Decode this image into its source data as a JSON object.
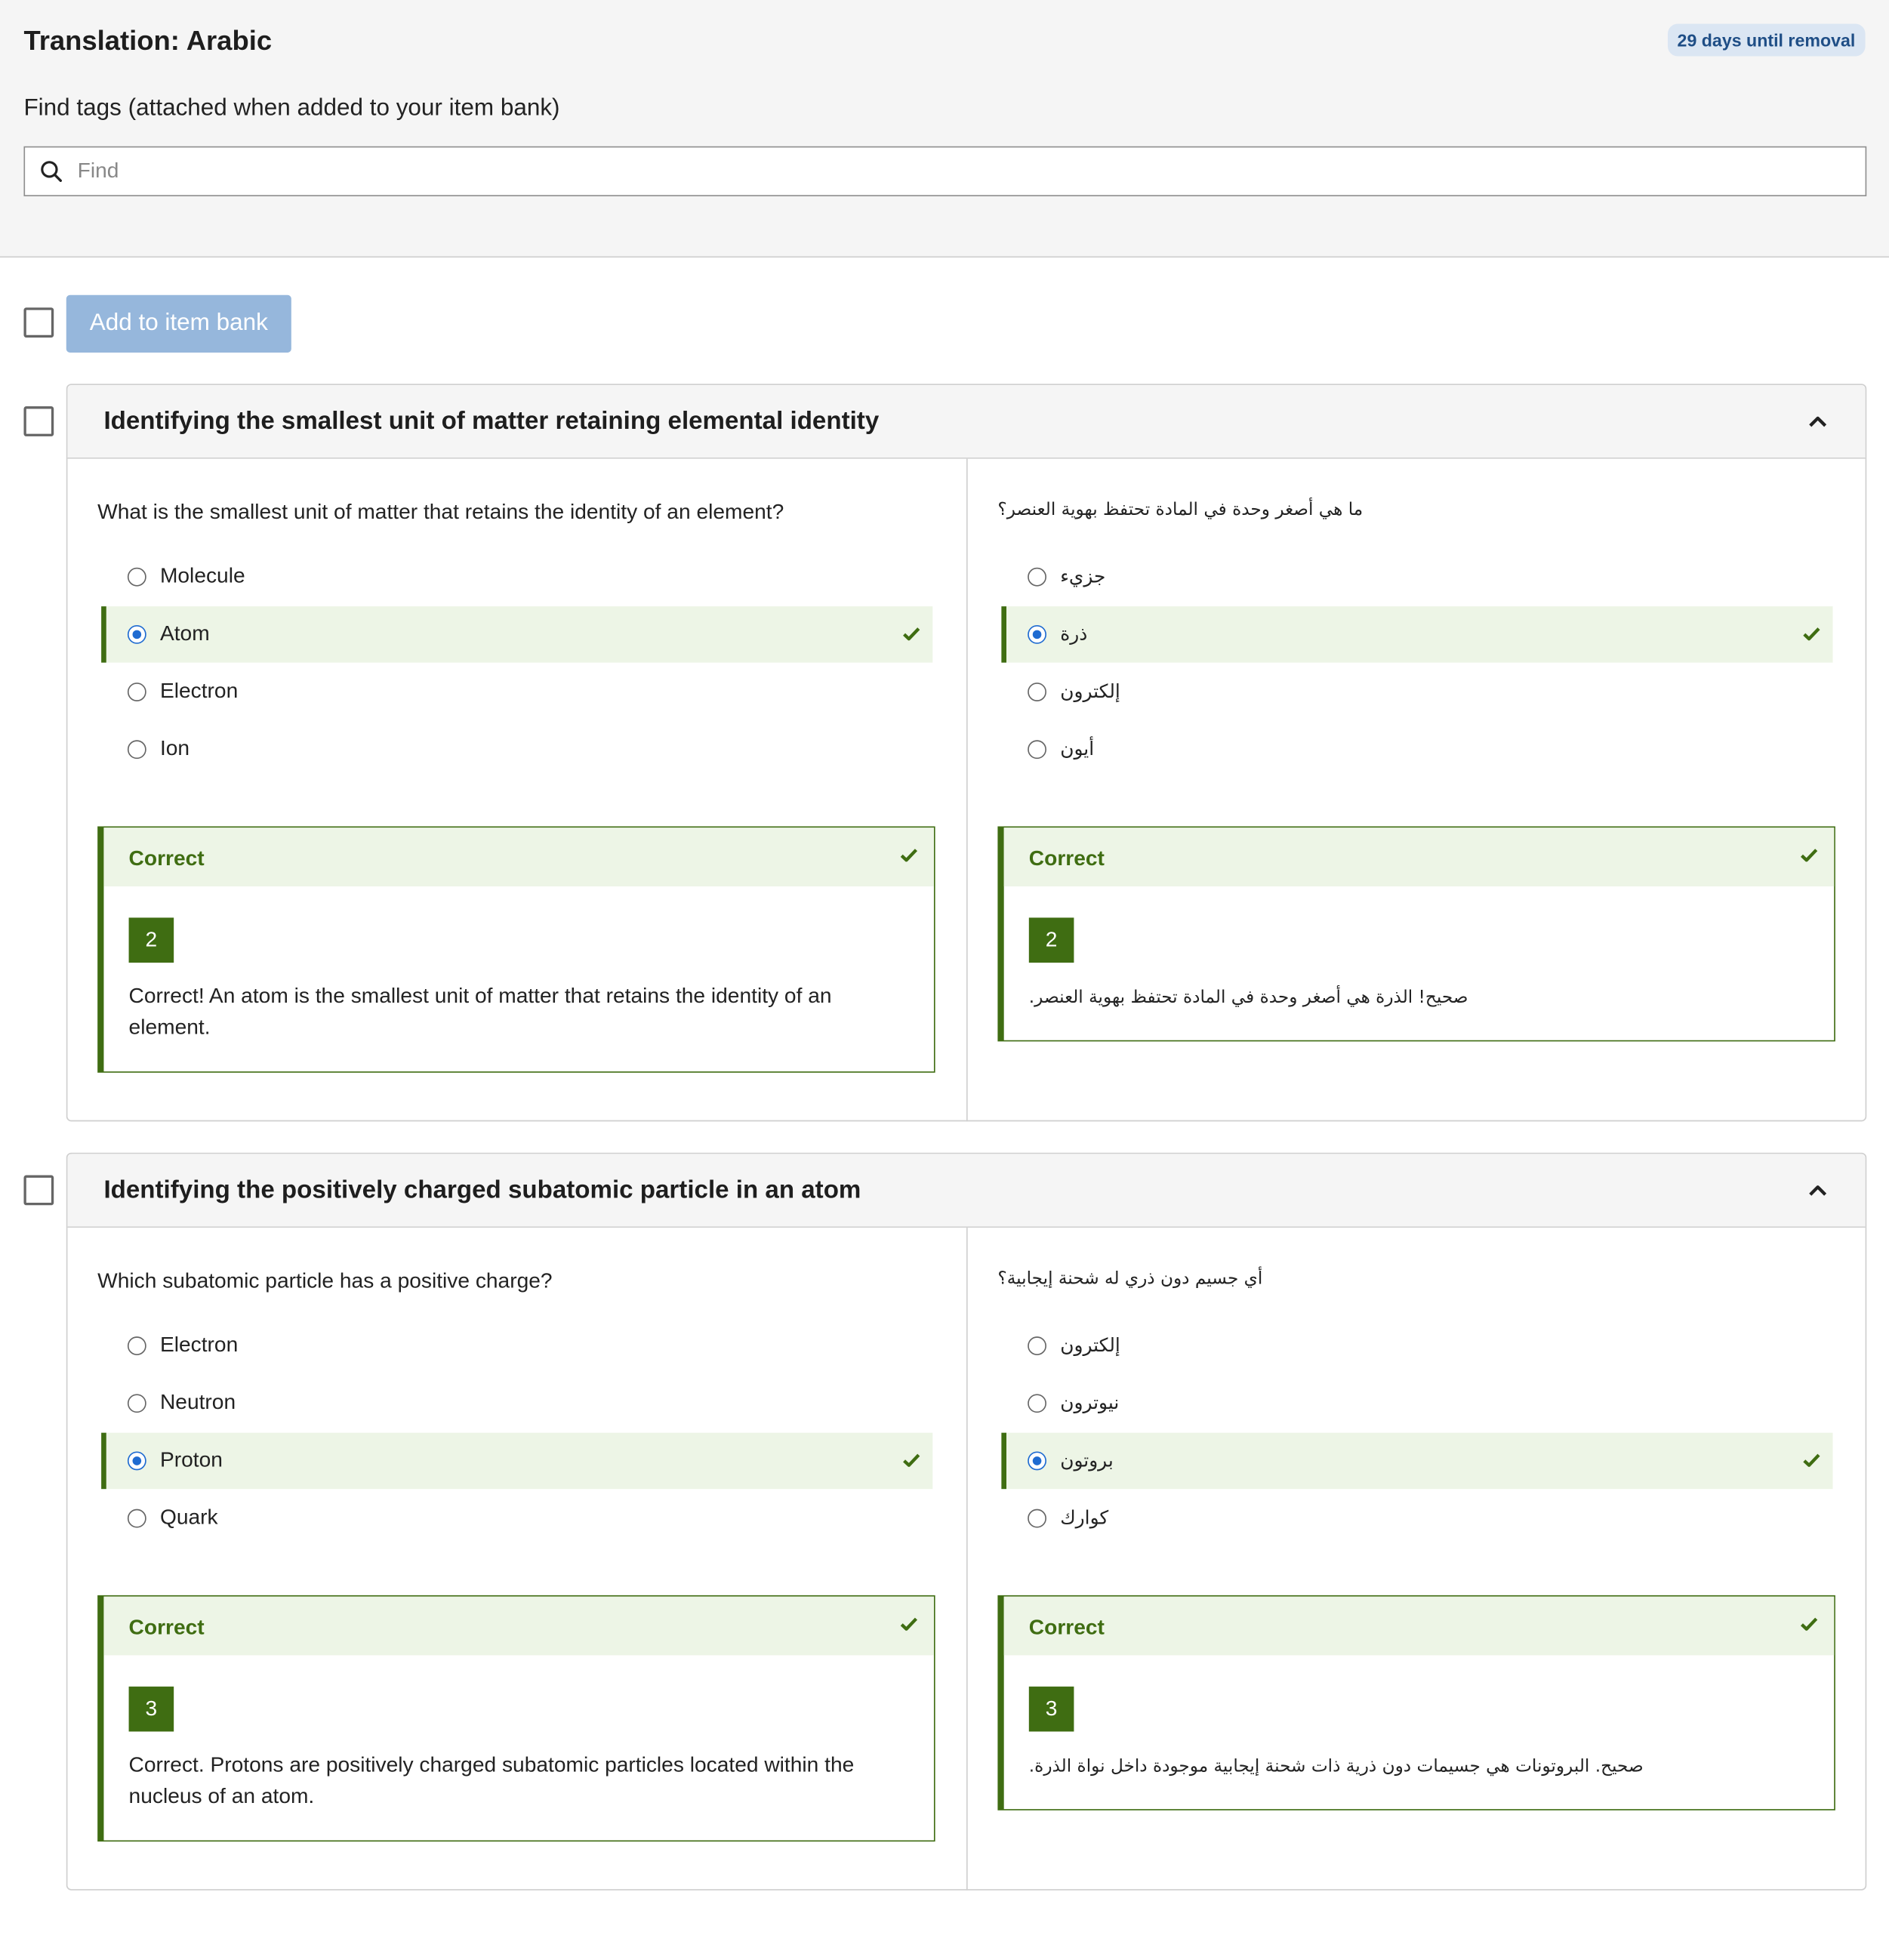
{
  "header": {
    "title": "Translation: Arabic",
    "badge": "29 days until removal",
    "find_label": "Find tags (attached when added to your item bank)",
    "search_placeholder": "Find"
  },
  "actions": {
    "add_button": "Add to item bank"
  },
  "items": [
    {
      "title": "Identifying the smallest unit of matter retaining elemental identity",
      "source": {
        "question": "What is the smallest unit of matter that retains the identity of an element?",
        "options": [
          "Molecule",
          "Atom",
          "Electron",
          "Ion"
        ],
        "correct_index": 1,
        "feedback_title": "Correct",
        "feedback_number": "2",
        "feedback_text": "Correct! An atom is the smallest unit of matter that retains the identity of an element."
      },
      "translation": {
        "question": "ما هي أصغر وحدة في المادة تحتفظ بهوية العنصر؟",
        "options": [
          "جزيء",
          "ذرة",
          "إلكترون",
          "أيون"
        ],
        "correct_index": 1,
        "feedback_title": "Correct",
        "feedback_number": "2",
        "feedback_text": "صحيح! الذرة هي أصغر وحدة في المادة تحتفظ بهوية العنصر."
      }
    },
    {
      "title": "Identifying the positively charged subatomic particle in an atom",
      "source": {
        "question": "Which subatomic particle has a positive charge?",
        "options": [
          "Electron",
          "Neutron",
          "Proton",
          "Quark"
        ],
        "correct_index": 2,
        "feedback_title": "Correct",
        "feedback_number": "3",
        "feedback_text": "Correct. Protons are positively charged subatomic particles located within the nucleus of an atom."
      },
      "translation": {
        "question": "أي جسيم دون ذري له شحنة إيجابية؟",
        "options": [
          "إلكترون",
          "نيوترون",
          "بروتون",
          "كوارك"
        ],
        "correct_index": 2,
        "feedback_title": "Correct",
        "feedback_number": "3",
        "feedback_text": "صحيح. البروتونات هي جسيمات دون ذرية ذات شحنة إيجابية موجودة داخل نواة الذرة."
      }
    }
  ],
  "colors": {
    "accent_green": "#3f6d12",
    "correct_bg": "#edf5e6",
    "radio_blue": "#1f6bd1",
    "button_disabled": "#96b7dc",
    "badge_bg": "#dbe6f3"
  }
}
